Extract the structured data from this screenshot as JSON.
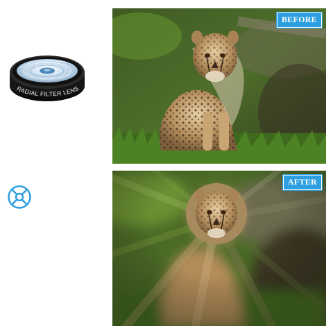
{
  "lens": {
    "label": "RADIAL FILTER LENS",
    "icon": "radial-filter-lens"
  },
  "effect_icon": {
    "icon": "radial-blur-icon",
    "color": "#2d9fe0"
  },
  "before_panel": {
    "badge": "BEFORE",
    "subject": "cheetah-cub-photo-sharp"
  },
  "after_panel": {
    "badge": "AFTER",
    "subject": "cheetah-cub-photo-radial-blur"
  },
  "colors": {
    "accent": "#2d9fe0",
    "badge_text": "#ffffff"
  }
}
